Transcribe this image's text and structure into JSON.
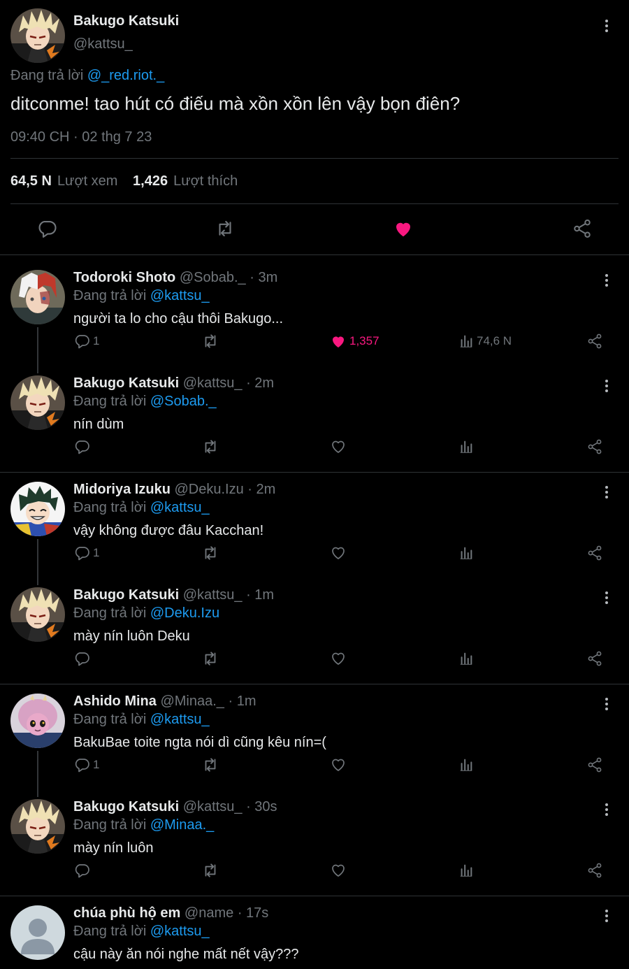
{
  "colors": {
    "background": "#000000",
    "text": "#e7e9ea",
    "muted": "#71767b",
    "link": "#1d9bf0",
    "like": "#f91880",
    "divider": "#2f3336"
  },
  "main_tweet": {
    "name": "Bakugo Katsuki",
    "handle": "@kattsu_",
    "replying_prefix": "Đang trả lời",
    "replying_to": "@_red.riot._",
    "text": "ditconme! tao hút có điếu mà xồn xồn lên vậy bọn điên?",
    "timestamp": "09:40 CH · 02 thg 7 23",
    "views_count": "64,5 N",
    "views_label": "Lượt xem",
    "likes_count": "1,426",
    "likes_label": "Lượt thích",
    "liked": true,
    "actions": [
      "reply-icon",
      "retweet-icon",
      "heart-icon",
      "share-icon"
    ]
  },
  "replies": [
    {
      "name": "Todoroki Shoto",
      "handle": "@Sobab._",
      "time": "· 3m",
      "replying_prefix": "Đang trả lời",
      "replying_to": "@kattsu_",
      "text": "người ta lo cho cậu thôi Bakugo...",
      "reply_count": "1",
      "like_count": "1,357",
      "view_count": "74,6 N",
      "liked": true,
      "avatar": "todoroki",
      "thread_line": true
    },
    {
      "name": "Bakugo Katsuki",
      "handle": "@kattsu_",
      "time": "· 2m",
      "replying_prefix": "Đang trả lời",
      "replying_to": "@Sobab._",
      "text": "nín dùm",
      "reply_count": "",
      "like_count": "",
      "view_count": "",
      "liked": false,
      "avatar": "bakugo",
      "thread_line": false
    },
    {
      "name": "Midoriya Izuku",
      "handle": "@Deku.Izu",
      "time": "· 2m",
      "replying_prefix": "Đang trả lời",
      "replying_to": "@kattsu_",
      "text": "vậy không được đâu Kacchan!",
      "reply_count": "1",
      "like_count": "",
      "view_count": "",
      "liked": false,
      "avatar": "midoriya",
      "thread_line": true
    },
    {
      "name": "Bakugo Katsuki",
      "handle": "@kattsu_",
      "time": "· 1m",
      "replying_prefix": "Đang trả lời",
      "replying_to": "@Deku.Izu",
      "text": "mày nín luôn Deku",
      "reply_count": "",
      "like_count": "",
      "view_count": "",
      "liked": false,
      "avatar": "bakugo",
      "thread_line": false
    },
    {
      "name": "Ashido Mina",
      "handle": "@Minaa._",
      "time": "· 1m",
      "replying_prefix": "Đang trả lời",
      "replying_to": "@kattsu_",
      "text": "BakuBae toite ngta nói dì cũng kêu nín=(",
      "reply_count": "1",
      "like_count": "",
      "view_count": "",
      "liked": false,
      "avatar": "ashido",
      "thread_line": true
    },
    {
      "name": "Bakugo Katsuki",
      "handle": "@kattsu_",
      "time": "· 30s",
      "replying_prefix": "Đang trả lời",
      "replying_to": "@Minaa._",
      "text": "mày nín luôn",
      "reply_count": "",
      "like_count": "",
      "view_count": "",
      "liked": false,
      "avatar": "bakugo",
      "thread_line": false
    },
    {
      "name": "chúa phù hộ em",
      "handle": "@name",
      "time": "· 17s",
      "replying_prefix": "Đang trả lời",
      "replying_to": "@kattsu_",
      "text": "cậu này ăn nói nghe mất nết vậy???",
      "reply_count": "",
      "like_count": "",
      "view_count": "",
      "liked": false,
      "avatar": "default",
      "thread_line": false
    }
  ]
}
